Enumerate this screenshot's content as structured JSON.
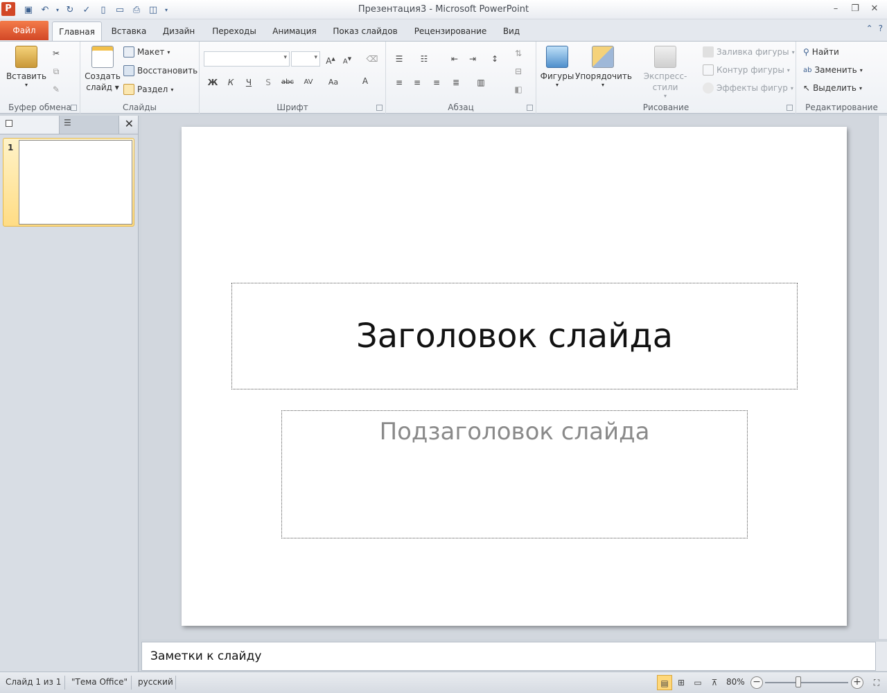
{
  "window": {
    "title": "Презентация3  -  Microsoft PowerPoint",
    "app_icon_letter": "P"
  },
  "tabs": {
    "file": "Файл",
    "items": [
      "Главная",
      "Вставка",
      "Дизайн",
      "Переходы",
      "Анимация",
      "Показ слайдов",
      "Рецензирование",
      "Вид"
    ],
    "active": "Главная"
  },
  "ribbon": {
    "clipboard": {
      "label": "Буфер обмена",
      "paste": "Вставить"
    },
    "slides": {
      "label": "Слайды",
      "new_slide_line1": "Создать",
      "new_slide_line2": "слайд",
      "layout": "Макет",
      "reset": "Восстановить",
      "section": "Раздел"
    },
    "font": {
      "label": "Шрифт"
    },
    "paragraph": {
      "label": "Абзац"
    },
    "drawing": {
      "label": "Рисование",
      "shapes": "Фигуры",
      "arrange": "Упорядочить",
      "quick_styles": "Экспресс-стили",
      "shape_fill": "Заливка фигуры",
      "shape_outline": "Контур фигуры",
      "shape_effects": "Эффекты фигур"
    },
    "editing": {
      "label": "Редактирование",
      "find": "Найти",
      "replace": "Заменить",
      "select": "Выделить"
    }
  },
  "slide_panel": {
    "slide_number": "1"
  },
  "slide": {
    "title": "Заголовок слайда",
    "subtitle": "Подзаголовок слайда"
  },
  "notes": {
    "placeholder": "Заметки к слайду"
  },
  "status": {
    "slide_of": "Слайд 1 из 1",
    "theme": "\"Тема Office\"",
    "language": "русский",
    "zoom": "80%",
    "zoom_level": 80
  },
  "colors": {
    "file_tab": "#d24726",
    "active_view": "#ffd87a",
    "thumb_selected": "#ffdc84"
  }
}
